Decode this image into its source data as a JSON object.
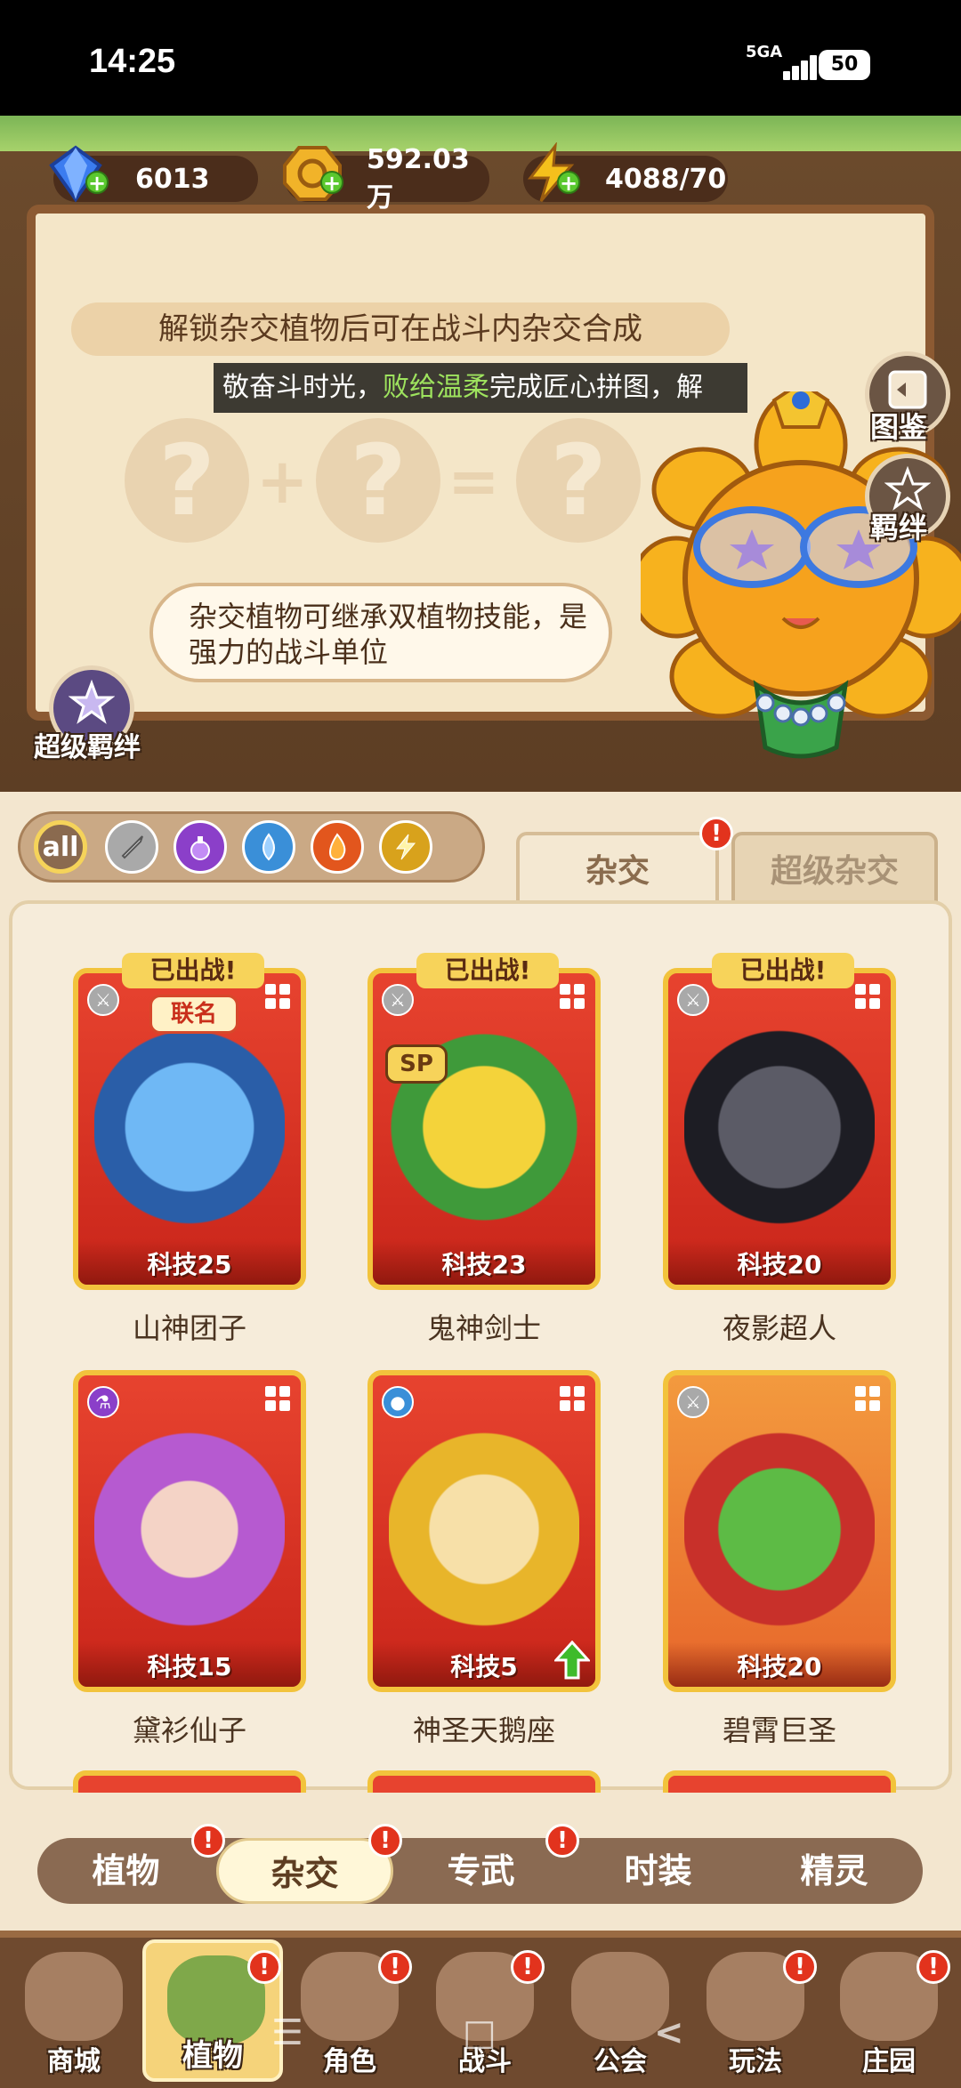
{
  "status": {
    "time": "14:25",
    "network": "5GA",
    "battery": "50"
  },
  "resources": {
    "gems": "6013",
    "coins": "592.03万",
    "energy": "4088/70"
  },
  "banner": {
    "hint": "解锁杂交植物后可在战斗内杂交合成",
    "ticker_a": "敬奋斗时光，",
    "ticker_highlight": "败给温柔",
    "ticker_b": "完成匠心拼图，解",
    "bubble": "杂交植物可继承双植物技能，是强力的战斗单位",
    "question": "?",
    "plus": "+",
    "equals": "="
  },
  "side_buttons": {
    "guide": "图鉴",
    "bond": "羁绊",
    "super_bond": "超级羁绊"
  },
  "filters": [
    "all"
  ],
  "top_tabs": [
    {
      "label": "杂交",
      "badge": "!"
    },
    {
      "label": "超级杂交"
    }
  ],
  "cards": [
    {
      "name": "山神团子",
      "level": "科技25",
      "deployed": "已出战!",
      "tag": "联名",
      "element": "sword",
      "style": "red"
    },
    {
      "name": "鬼神剑士",
      "level": "科技23",
      "deployed": "已出战!",
      "tag": "SP",
      "element": "sword",
      "style": "red"
    },
    {
      "name": "夜影超人",
      "level": "科技20",
      "deployed": "已出战!",
      "element": "sword",
      "style": "red"
    },
    {
      "name": "黛衫仙子",
      "level": "科技15",
      "element": "potion",
      "style": "red"
    },
    {
      "name": "神圣天鹅座",
      "level": "科技5",
      "element": "water",
      "style": "red",
      "upgrade": true
    },
    {
      "name": "碧霄巨圣",
      "level": "科技20",
      "element": "sword",
      "style": "orange"
    }
  ],
  "sub_tabs": [
    {
      "label": "植物",
      "badge": "!"
    },
    {
      "label": "杂交",
      "badge": "!",
      "active": true
    },
    {
      "label": "专武",
      "badge": "!"
    },
    {
      "label": "时装"
    },
    {
      "label": "精灵"
    }
  ],
  "bottom_nav": [
    {
      "label": "商城"
    },
    {
      "label": "植物",
      "badge": "!",
      "active": true
    },
    {
      "label": "角色",
      "badge": "!"
    },
    {
      "label": "战斗",
      "badge": "!"
    },
    {
      "label": "公会"
    },
    {
      "label": "玩法",
      "badge": "!"
    },
    {
      "label": "庄园",
      "badge": "!"
    }
  ],
  "colors": {
    "accent": "#e7432f",
    "card_border": "#f2c33c",
    "badge": "#e2331d",
    "highlight_text": "#9ee35e"
  }
}
